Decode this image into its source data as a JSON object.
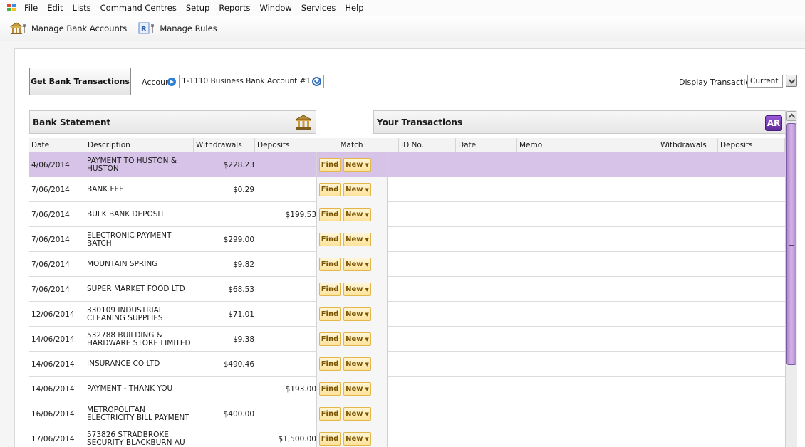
{
  "menu": [
    "File",
    "Edit",
    "Lists",
    "Command Centres",
    "Setup",
    "Reports",
    "Window",
    "Services",
    "Help"
  ],
  "toolbar": {
    "manage_bank_accounts": "Manage Bank Accounts",
    "manage_rules": "Manage Rules",
    "rules_icon_letter": "R"
  },
  "controls": {
    "get_button": "Get Bank Transactions",
    "account_label": "Account",
    "account_value": "1-1110 Business Bank Account #1",
    "display_label": "Display Transactions:",
    "display_value": "Current"
  },
  "bank_statement": {
    "title": "Bank Statement",
    "columns": [
      "Date",
      "Description",
      "Withdrawals",
      "Deposits",
      "Match"
    ],
    "find_label": "Find",
    "new_label": "New",
    "rows": [
      {
        "date": "4/06/2014",
        "desc": "PAYMENT TO HUSTON & HUSTON",
        "withdrawal": "$228.23",
        "deposit": ""
      },
      {
        "date": "7/06/2014",
        "desc": "BANK FEE",
        "withdrawal": "$0.29",
        "deposit": ""
      },
      {
        "date": "7/06/2014",
        "desc": "BULK BANK DEPOSIT",
        "withdrawal": "",
        "deposit": "$199.53"
      },
      {
        "date": "7/06/2014",
        "desc": "ELECTRONIC PAYMENT BATCH",
        "withdrawal": "$299.00",
        "deposit": ""
      },
      {
        "date": "7/06/2014",
        "desc": "MOUNTAIN SPRING",
        "withdrawal": "$9.82",
        "deposit": ""
      },
      {
        "date": "7/06/2014",
        "desc": "SUPER MARKET FOOD LTD",
        "withdrawal": "$68.53",
        "deposit": ""
      },
      {
        "date": "12/06/2014",
        "desc": "330109 INDUSTRIAL CLEANING SUPPLIES",
        "withdrawal": "$71.01",
        "deposit": ""
      },
      {
        "date": "14/06/2014",
        "desc": "532788 BUILDING & HARDWARE STORE LIMITED",
        "withdrawal": "$9.38",
        "deposit": ""
      },
      {
        "date": "14/06/2014",
        "desc": "INSURANCE CO LTD",
        "withdrawal": "$490.46",
        "deposit": ""
      },
      {
        "date": "14/06/2014",
        "desc": "PAYMENT - THANK YOU",
        "withdrawal": "",
        "deposit": "$193.00"
      },
      {
        "date": "16/06/2014",
        "desc": "METROPOLITAN ELECTRICITY BILL PAYMENT",
        "withdrawal": "$400.00",
        "deposit": ""
      },
      {
        "date": "17/06/2014",
        "desc": "573826 STRADBROKE SECURITY BLACKBURN AU",
        "withdrawal": "",
        "deposit": "$1,500.00"
      }
    ]
  },
  "your_transactions": {
    "title": "Your Transactions",
    "columns": [
      "ID No.",
      "Date",
      "Memo",
      "Withdrawals",
      "Deposits"
    ],
    "badge": "AR"
  },
  "colors": {
    "selected_row": "#d8c3e8",
    "button_fill": "#fde29a",
    "scroll_thumb": "#b28ad0",
    "accent_blue": "#2e7fd3"
  }
}
